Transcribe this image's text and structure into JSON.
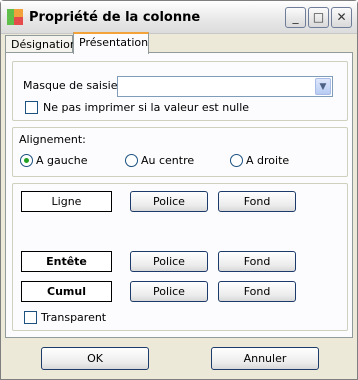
{
  "window": {
    "title": "Propriété de la colonne"
  },
  "titlebar": {
    "minimize": "_",
    "maximize": "□",
    "close": "✕"
  },
  "tabs": [
    "Désignation",
    "Présentation"
  ],
  "mask": {
    "label": "Masque de saisie:",
    "value": "",
    "dropdown_glyph": "▼"
  },
  "no_print": {
    "label": "Ne pas imprimer si la valeur est nulle",
    "checked": false
  },
  "alignment": {
    "label": "Alignement:",
    "options": [
      "A gauche",
      "Au centre",
      "A droite"
    ],
    "selected": "A gauche"
  },
  "rows": [
    {
      "label": "Ligne",
      "font_btn": "Police",
      "bg_btn": "Fond"
    },
    {
      "label": "Entête",
      "font_btn": "Police",
      "bg_btn": "Fond"
    },
    {
      "label": "Cumul",
      "font_btn": "Police",
      "bg_btn": "Fond"
    }
  ],
  "transparent": {
    "label": "Transparent",
    "checked": false
  },
  "footer": {
    "ok": "OK",
    "cancel": "Annuler"
  }
}
